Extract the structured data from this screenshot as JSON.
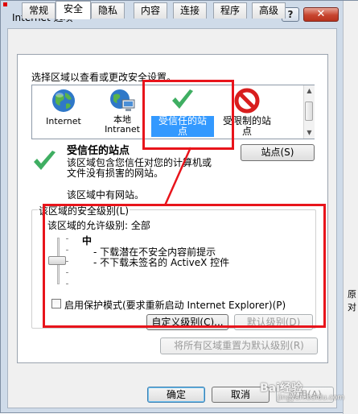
{
  "window": {
    "title": "Internet 选项",
    "help_label": "?",
    "close_label": "✕",
    "right_fragments": [
      "\\",
      "​i",
      "e",
      "b",
      "原对"
    ]
  },
  "tabs": [
    {
      "label": "常规"
    },
    {
      "label": "安全",
      "active": true
    },
    {
      "label": "隐私"
    },
    {
      "label": "内容"
    },
    {
      "label": "连接"
    },
    {
      "label": "程序"
    },
    {
      "label": "高级"
    }
  ],
  "security": {
    "instruction": "选择区域以查看或更改安全设置。",
    "zones": [
      {
        "label": "Internet",
        "icon": "globe-icon"
      },
      {
        "label": "本地\nIntranet",
        "icon": "intranet-icon"
      },
      {
        "label": "受信任的站\n点",
        "icon": "checkmark-icon",
        "selected": true
      },
      {
        "label": "受限制的站\n点",
        "icon": "no-entry-icon"
      }
    ],
    "sites_button": "站点(S)",
    "zone_title": "受信任的站点",
    "zone_desc": "该区域包含您信任对您的计算机或\n文件没有损害的网站。",
    "zone_nosites": "该区域中有网站。",
    "level_group_label": "该区域的安全级别(L)",
    "allowed_levels": "该区域的允许级别: 全部",
    "level_name": "中",
    "level_bullets": [
      "- 下载潜在不安全内容前提示",
      "- 不下载未签名的 ActiveX 控件"
    ],
    "protected_mode_label": "启用保护模式(要求重新启动 Internet Explorer)(P)",
    "protected_mode_checked": false,
    "custom_level_button": "自定义级别(C)...",
    "default_level_button": "默认级别(D)",
    "reset_all_button": "将所有区域重置为默认级别(R)"
  },
  "footer": {
    "ok": "确定",
    "cancel": "取消",
    "apply": "应用(A)"
  },
  "watermark": {
    "text": "Bai经验",
    "sub": "jingyan.baidu.com"
  },
  "colors": {
    "annotation": "#e8141b",
    "selection": "#3399ff"
  }
}
